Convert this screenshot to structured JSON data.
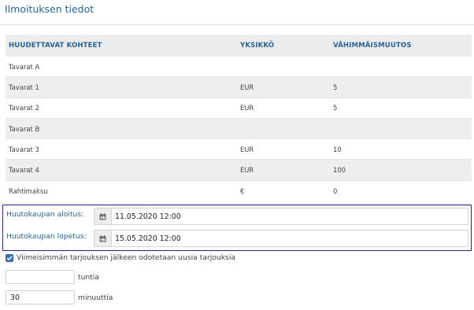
{
  "page": {
    "title": "Ilmoituksen tiedot"
  },
  "table": {
    "headers": {
      "name": "HUUDETTAVAT KOHTEET",
      "unit": "YKSIKKÖ",
      "min": "VÄHIMMÄISMUUTOS"
    },
    "rows": [
      {
        "name": "Tavarat A",
        "unit": "",
        "min": ""
      },
      {
        "name": "Tavarat 1",
        "unit": "EUR",
        "min": "5"
      },
      {
        "name": "Tavarat 2",
        "unit": "EUR",
        "min": "5"
      },
      {
        "name": "Tavarat B",
        "unit": "",
        "min": ""
      },
      {
        "name": "Tavarat 3",
        "unit": "EUR",
        "min": "10"
      },
      {
        "name": "Tavarat 4",
        "unit": "EUR",
        "min": "100"
      },
      {
        "name": "Rahtimaksu",
        "unit": "€",
        "min": "0"
      }
    ]
  },
  "auction": {
    "start": {
      "label": "Huutokaupan aloitus:",
      "value": "11.05.2020 12:00",
      "icon": "calendar-icon"
    },
    "end": {
      "label": "Huutokaupan lopetus:",
      "value": "15.05.2020 12:00",
      "icon": "calendar-icon"
    }
  },
  "wait": {
    "checkbox_label": "Viimeisimmän tarjouksen jälkeen odotetaan uusia tarjouksia",
    "checked": true,
    "hours": {
      "value": "",
      "unit": "tuntia"
    },
    "minutes": {
      "value": "30",
      "unit": "minuuttia"
    }
  },
  "colors": {
    "accent": "#2a6496",
    "highlight_border": "#23238e",
    "checkbox": "#2f6fb8"
  }
}
